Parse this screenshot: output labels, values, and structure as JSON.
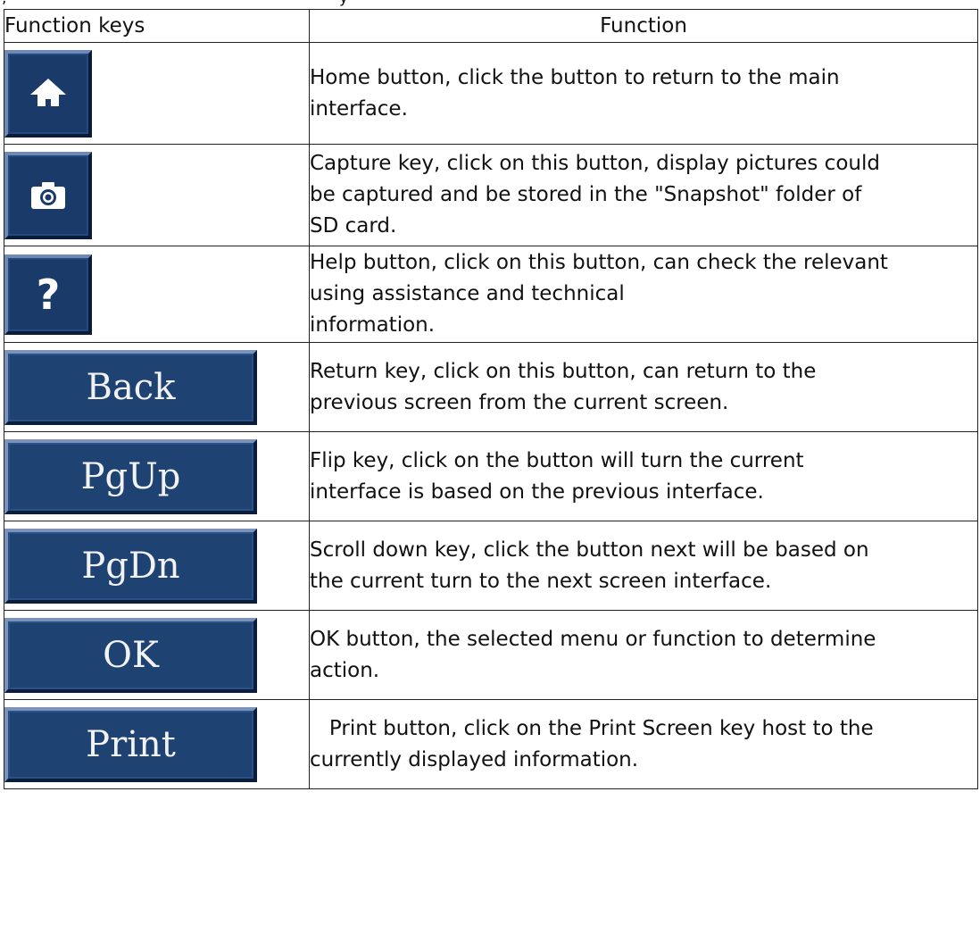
{
  "table": {
    "headers": {
      "keys": "Function keys",
      "function": "Function"
    },
    "rows": [
      {
        "icon": "home-icon",
        "desc": [
          "Home button, click the button to return to the main",
          "interface."
        ]
      },
      {
        "icon": "camera-icon",
        "desc": [
          "Capture key, click on this button, display pictures could",
          "be captured and be stored in the \"Snapshot\" folder of",
          "SD card."
        ]
      },
      {
        "icon": "help-icon",
        "key_label": "?",
        "desc": [
          "Help button, click on this button, can check the relevant",
          "using assistance and technical",
          "information."
        ]
      },
      {
        "key_label": "Back",
        "desc": [
          "Return key, click on this button, can return to the",
          "previous screen from the current screen."
        ]
      },
      {
        "key_label": "PgUp",
        "desc": [
          "Flip key, click on the button will turn the current",
          "interface is based on the previous interface."
        ]
      },
      {
        "key_label": "PgDn",
        "desc": [
          "Scroll down key, click the button next will be based on",
          "the current turn to the next screen interface."
        ]
      },
      {
        "key_label": "OK",
        "desc": [
          "OK button, the selected menu or function to determine",
          "action."
        ]
      },
      {
        "key_label": "Print",
        "desc": [
          "   Print button, click on the Print Screen key host to the",
          "currently displayed information."
        ]
      }
    ]
  },
  "colors": {
    "button_bg": "#1e4372",
    "button_text": "#f2f2f2"
  }
}
